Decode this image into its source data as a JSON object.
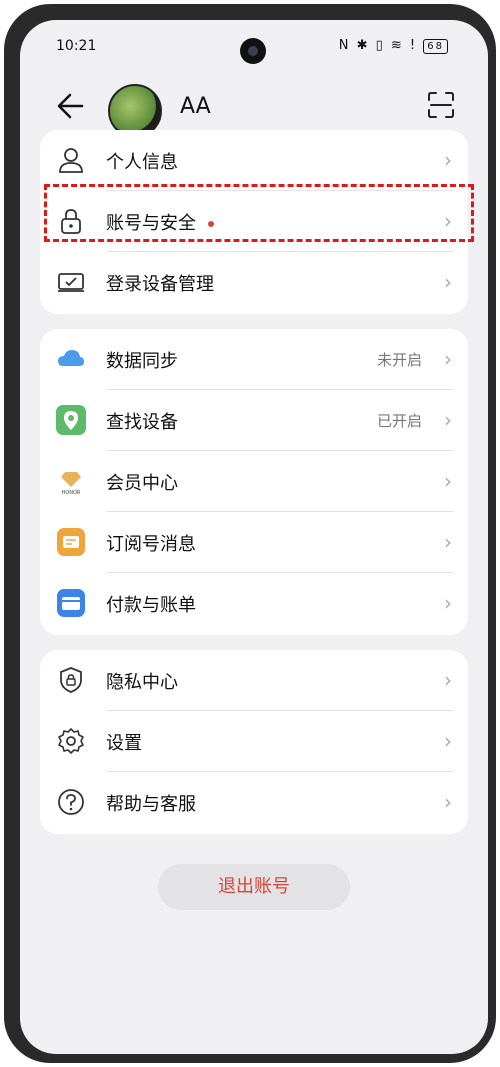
{
  "status_bar": {
    "time": "10:21",
    "icons_text": "N ✱ ▯ ≋ !",
    "battery": "68"
  },
  "header": {
    "username": "AA"
  },
  "group1": [
    {
      "label": "个人信息",
      "icon": "person-icon"
    },
    {
      "label": "账号与安全",
      "icon": "lock-icon",
      "has_dot": true
    },
    {
      "label": "登录设备管理",
      "icon": "device-icon"
    }
  ],
  "group2": [
    {
      "label": "数据同步",
      "value": "未开启",
      "icon": "cloud-icon"
    },
    {
      "label": "查找设备",
      "value": "已开启",
      "icon": "find-device-icon"
    },
    {
      "label": "会员中心",
      "icon": "honor-member-icon",
      "icon_text": "HONOR"
    },
    {
      "label": "订阅号消息",
      "icon": "subscription-icon"
    },
    {
      "label": "付款与账单",
      "icon": "payment-card-icon"
    }
  ],
  "group3": [
    {
      "label": "隐私中心",
      "icon": "privacy-shield-icon"
    },
    {
      "label": "设置",
      "icon": "gear-icon"
    },
    {
      "label": "帮助与客服",
      "icon": "help-icon"
    }
  ],
  "logout_label": "退出账号",
  "colors": {
    "accent_red": "#d9453b",
    "background": "#f0f0f2",
    "card": "#ffffff"
  }
}
